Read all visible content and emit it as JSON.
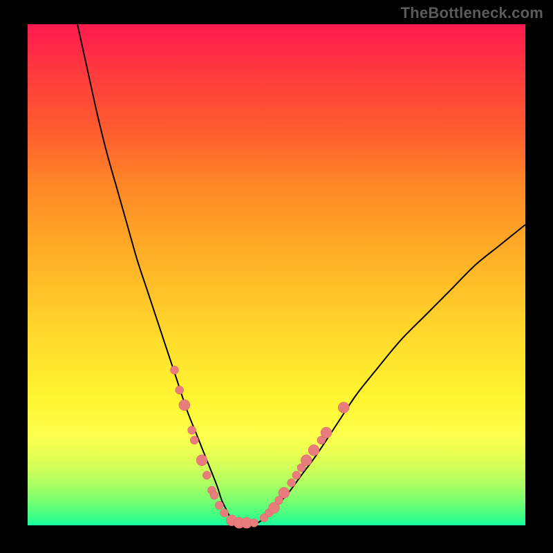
{
  "watermark": "TheBottleneck.com",
  "colors": {
    "frame": "#000000",
    "curve": "#000000",
    "dot_fill": "#e97c7c",
    "dot_stroke": "#d45f5f",
    "gradient_top": "#ff1a50",
    "gradient_bottom": "#18ffa0"
  },
  "chart_data": {
    "type": "line",
    "title": "",
    "xlabel": "",
    "ylabel": "",
    "xlim": [
      0,
      100
    ],
    "ylim": [
      0,
      100
    ],
    "series": [
      {
        "name": "curve",
        "x": [
          10,
          12,
          14,
          16,
          18,
          20,
          22,
          24,
          26,
          28,
          30,
          32,
          34,
          36,
          38,
          39,
          40,
          41,
          42,
          43,
          45,
          47,
          49,
          52,
          55,
          58,
          62,
          66,
          70,
          75,
          80,
          85,
          90,
          95,
          100
        ],
        "values": [
          100,
          91,
          82,
          74,
          67,
          60,
          53,
          47,
          41,
          35,
          29,
          23,
          18,
          13,
          8,
          5,
          3,
          1,
          0,
          0,
          0,
          1,
          3,
          6,
          10,
          14,
          20,
          26,
          31,
          37,
          42,
          47,
          52,
          56,
          60
        ]
      }
    ],
    "points": [
      {
        "x": 29.5,
        "y": 31,
        "r": 6
      },
      {
        "x": 30.5,
        "y": 27,
        "r": 6
      },
      {
        "x": 31.5,
        "y": 24,
        "r": 8
      },
      {
        "x": 33.0,
        "y": 19,
        "r": 6
      },
      {
        "x": 33.5,
        "y": 17,
        "r": 6
      },
      {
        "x": 35.0,
        "y": 13,
        "r": 8
      },
      {
        "x": 36.0,
        "y": 10,
        "r": 6
      },
      {
        "x": 37.0,
        "y": 7,
        "r": 6
      },
      {
        "x": 37.5,
        "y": 6,
        "r": 6
      },
      {
        "x": 38.5,
        "y": 4,
        "r": 6
      },
      {
        "x": 39.5,
        "y": 2.5,
        "r": 6
      },
      {
        "x": 41.0,
        "y": 1,
        "r": 8
      },
      {
        "x": 42.5,
        "y": 0.5,
        "r": 8
      },
      {
        "x": 44.0,
        "y": 0.5,
        "r": 8
      },
      {
        "x": 45.5,
        "y": 0.5,
        "r": 6
      },
      {
        "x": 47.5,
        "y": 1.5,
        "r": 6
      },
      {
        "x": 48.5,
        "y": 2.5,
        "r": 6
      },
      {
        "x": 49.5,
        "y": 3.5,
        "r": 8
      },
      {
        "x": 50.5,
        "y": 5,
        "r": 6
      },
      {
        "x": 51.5,
        "y": 6.5,
        "r": 8
      },
      {
        "x": 53.0,
        "y": 8.5,
        "r": 6
      },
      {
        "x": 54.0,
        "y": 10,
        "r": 6
      },
      {
        "x": 55.0,
        "y": 11.5,
        "r": 6
      },
      {
        "x": 56.0,
        "y": 13,
        "r": 8
      },
      {
        "x": 57.5,
        "y": 15,
        "r": 8
      },
      {
        "x": 59.0,
        "y": 17,
        "r": 6
      },
      {
        "x": 60.0,
        "y": 18.5,
        "r": 8
      },
      {
        "x": 63.5,
        "y": 23.5,
        "r": 8
      }
    ]
  }
}
